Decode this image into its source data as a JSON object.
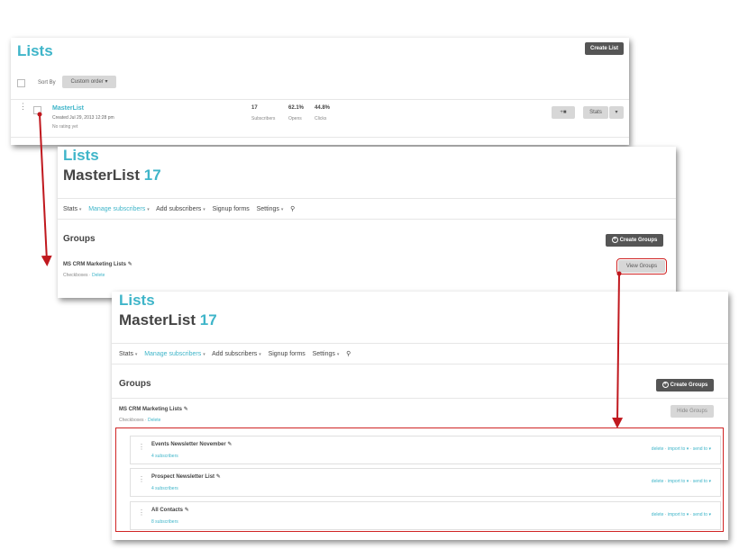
{
  "panel1": {
    "title": "Lists",
    "create_list": "Create List",
    "sort_by": "Sort By",
    "sort_value": "Custom order",
    "list": {
      "name": "MasterList",
      "created": "Created Jul 29, 2013 12:28 pm",
      "rating": "No rating yet",
      "subscribers_value": "17",
      "subscribers_label": "Subscribers",
      "opens_value": "62.1%",
      "opens_label": "Opens",
      "clicks_value": "44.8%",
      "clicks_label": "Clicks",
      "stats_button": "Stats"
    }
  },
  "detail": {
    "breadcrumb": "Lists",
    "list_name": "MasterList",
    "count": "17",
    "nav": {
      "stats": "Stats",
      "manage": "Manage subscribers",
      "add": "Add subscribers",
      "signup": "Signup forms",
      "settings": "Settings"
    },
    "groups_heading": "Groups",
    "create_groups": "Create Groups",
    "group_name": "MS CRM Marketing Lists",
    "group_type": "Checkboxes",
    "group_delete": "Delete",
    "view_groups": "View Groups",
    "hide_groups": "Hide Groups"
  },
  "groups": [
    {
      "name": "Events Newsletter November",
      "subs": "4 subscribers"
    },
    {
      "name": "Prospect Newsletter List",
      "subs": "4 subscribers"
    },
    {
      "name": "All Contacts",
      "subs": "8 subscribers"
    }
  ],
  "group_actions": {
    "delete": "delete",
    "import": "import to",
    "send": "send to"
  },
  "colors": {
    "accent": "#3fb5c9",
    "highlight": "#d02424",
    "dark_button": "#555555"
  }
}
